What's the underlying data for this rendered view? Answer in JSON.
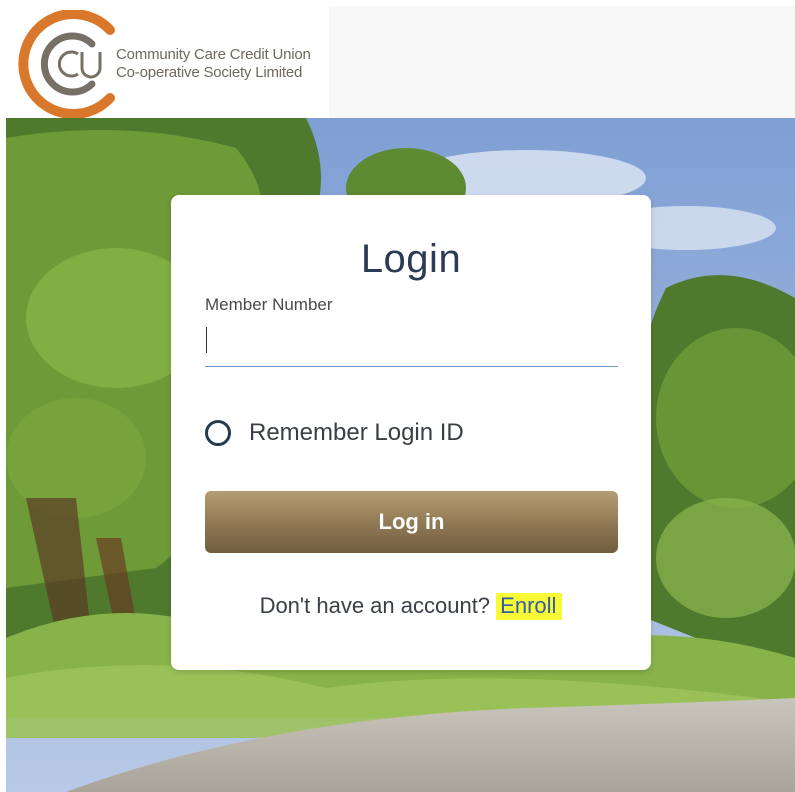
{
  "brand": {
    "line1": "Community Care Credit Union",
    "line2": "Co-operative Society Limited",
    "monogram": "CCU",
    "colors": {
      "orange": "#d9782b",
      "gray": "#777067"
    }
  },
  "login": {
    "title": "Login",
    "member_number_label": "Member Number",
    "member_number_value": "",
    "remember_label": "Remember Login ID",
    "remember_checked": false,
    "submit_label": "Log in",
    "signup_prompt": "Don't have an account?",
    "signup_link": "Enroll"
  },
  "colors": {
    "button_top": "#b69d72",
    "button_bottom": "#725e3f",
    "highlight": "#f9f936",
    "title": "#2b3a55"
  }
}
